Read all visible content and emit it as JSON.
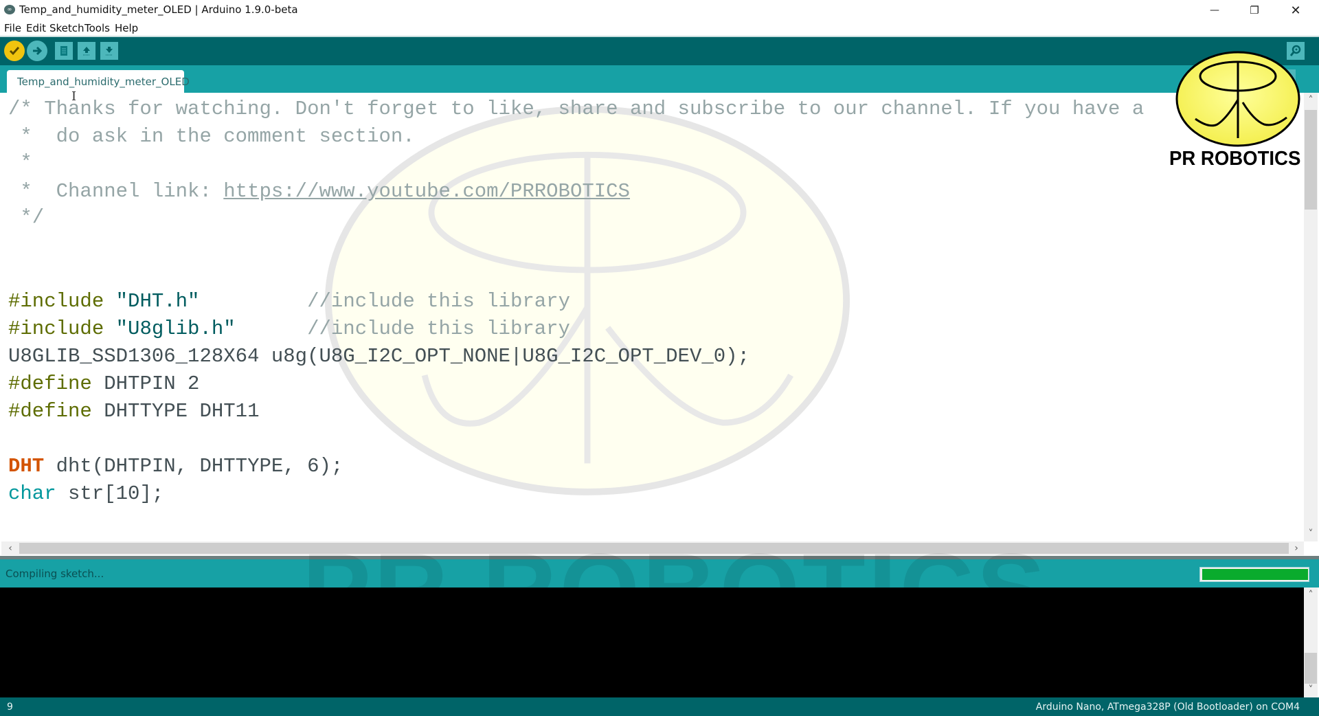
{
  "window": {
    "title": "Temp_and_humidity_meter_OLED | Arduino 1.9.0-beta",
    "minimize_icon": "—",
    "restore_icon": "❐",
    "close_icon": "✕"
  },
  "menu": [
    "File",
    "Edit",
    "Sketch",
    "Tools",
    "Help"
  ],
  "toolbar": {
    "verify": "verify-checkmark-icon",
    "upload": "upload-arrow-icon",
    "new": "new-file-icon",
    "open": "open-icon",
    "save": "save-icon",
    "serial_monitor": "serial-monitor-icon"
  },
  "tabs": [
    {
      "label": "Temp_and_humidity_meter_OLED",
      "active": true
    }
  ],
  "editor": {
    "comment": {
      "line1": "/* Thanks for watching. Don't forget to like, share and subscribe to our channel. If you have a",
      "line2": " *  do ask in the comment section.",
      "line3": " *",
      "line4_prefix": " *  Channel link: ",
      "line4_link": "https://www.youtube.com/PRROBOTICS",
      "line5": " */"
    },
    "include1": {
      "directive": "#include",
      "file": "\"DHT.h\"",
      "pad": "         ",
      "comment": "//include this library"
    },
    "include2": {
      "directive": "#include",
      "file": "\"U8glib.h\"",
      "pad": "      ",
      "comment": "//include this library"
    },
    "u8g_line": "U8GLIB_SSD1306_128X64 u8g(U8G_I2C_OPT_NONE|U8G_I2C_OPT_DEV_0);",
    "define1": {
      "directive": "#define",
      "rest": " DHTPIN 2"
    },
    "define2": {
      "directive": "#define",
      "rest": " DHTTYPE DHT11"
    },
    "dht_line": {
      "type": "DHT",
      "rest": " dht(DHTPIN, DHTTYPE, 6);"
    },
    "char_line": {
      "type": "char",
      "rest": " str[10];"
    }
  },
  "status": {
    "message": "Compiling sketch...",
    "progress_percent": 100
  },
  "footer": {
    "line_number": "9",
    "board": "Arduino Nano, ATmega328P (Old Bootloader) on COM4"
  },
  "overlay": {
    "logo_text": "PR ROBOTICS",
    "watermark_text": "PR ROBOTICS"
  },
  "colors": {
    "toolbar": "#006468",
    "tabbar": "#17a1a5",
    "verify_button": "#f1c40f",
    "progress_fill": "#0aab2d"
  }
}
